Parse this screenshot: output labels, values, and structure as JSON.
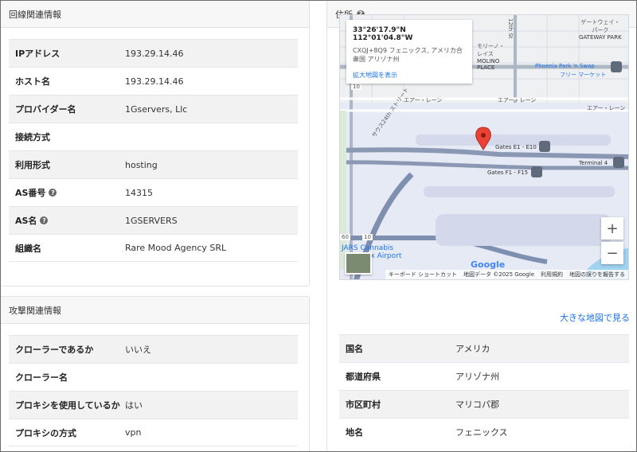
{
  "line_info": {
    "title": "回線関連情報",
    "rows": [
      {
        "key": "IPアドレス",
        "value": "193.29.14.46",
        "help": false
      },
      {
        "key": "ホスト名",
        "value": "193.29.14.46",
        "help": false
      },
      {
        "key": "プロバイダー名",
        "value": "1Gservers, Llc",
        "help": false
      },
      {
        "key": "接続方式",
        "value": "",
        "help": false
      },
      {
        "key": "利用形式",
        "value": "hosting",
        "help": false
      },
      {
        "key": "AS番号",
        "value": "14315",
        "help": true
      },
      {
        "key": "AS名",
        "value": "1GSERVERS",
        "help": true
      },
      {
        "key": "組織名",
        "value": "Rare Mood Agency SRL",
        "help": false
      }
    ]
  },
  "attack_info": {
    "title": "攻撃関連情報",
    "rows": [
      {
        "key": "クローラーであるか",
        "value": "いいえ"
      },
      {
        "key": "クローラー名",
        "value": ""
      },
      {
        "key": "プロキシを使用しているか",
        "value": "はい"
      },
      {
        "key": "プロキシの方式",
        "value": "vpn"
      }
    ]
  },
  "address": {
    "title": "住所",
    "map": {
      "coord": "33°26'17.9\"N 112°01'04.8\"W",
      "addr_line1": "CXQJ+8Q9 フェニックス, アメリカ合",
      "addr_line2": "衆国 アリゾナ州",
      "enlarge_link": "拡大地図を表示",
      "labels": {
        "gateway1": "ゲートウェイ・",
        "gateway2": "パーク",
        "gateway3": "GATEWAY PARK",
        "motherland1": "モリーノ・",
        "motherland2": "レイス",
        "motherland3": "MOLINO",
        "motherland4": "PLACE",
        "street": "12th St",
        "phoenix_park": "Phoenix Park 'n Swap",
        "free_market": "フリー マーケット",
        "airlane1": "エアー・レーン",
        "airlane2": "エアー・レーン",
        "airlane3": "エアー・レーン",
        "south24": "サウス24th ストリート",
        "gates_e": "Gates E1 - E10",
        "gates_f": "Gates F1 - F15",
        "terminal": "Terminal 4",
        "jars1": "JARS Cannabis",
        "jars2": "Phoenix Airport",
        "route10a": "10",
        "route10b": "10",
        "route60": "60"
      },
      "zoom_in": "+",
      "zoom_out": "−",
      "google": "Google",
      "footer": [
        "キーボード ショートカット",
        "地図データ ©2025 Google",
        "利用規約",
        "地図の誤りを報告する"
      ]
    },
    "big_map_link": "大きな地図で見る",
    "rows": [
      {
        "key": "国名",
        "value": "アメリカ"
      },
      {
        "key": "都道府県",
        "value": "アリゾナ州"
      },
      {
        "key": "市区町村",
        "value": "マリコパ郡"
      },
      {
        "key": "地名",
        "value": "フェニックス"
      }
    ]
  },
  "colors": {
    "map_bg": "#e8ecf2",
    "pin": "#ea4335",
    "link": "#1a73e8",
    "water": "#9fd3f0"
  }
}
